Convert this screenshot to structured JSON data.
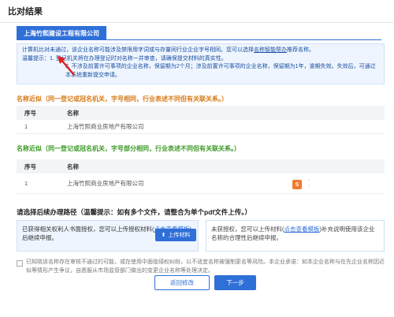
{
  "header": {
    "title": "比对结果"
  },
  "tab": {
    "company": "上海竹熙建设工程有限公司"
  },
  "notice": {
    "line1_prefix": "计算机比对未通过，该企业名称可能涉及禁限用字词或与存量同行业企业字号相同。您可以选择",
    "line1_link": "名称智能帮办",
    "line1_suffix": "推荐名称。",
    "line2": "温馨提示：1. 登记机关将在办理登记时对名称一并审查，请确保提交材料的真实性。",
    "line3": "2. 不涉及前置许可事项的企业名称，保留期为2个月；涉及前置许可事项的企业名称，保留期为1年，逾期失效。失效后，可通过本系统重新提交申请。"
  },
  "section1": {
    "title": "名称近似（同一登记或冠名机关，字号相同，行业表述不同但有关联关系。）",
    "columns": [
      "序号",
      "名称"
    ],
    "rows": [
      [
        "1",
        "上海竹熙商业房地产有限公司"
      ]
    ]
  },
  "section2": {
    "title": "名称近似（同一登记或冠名机关，字号部分相同，行业表述不同但有关联关系。）",
    "columns": [
      "序号",
      "名称"
    ],
    "rows": [
      [
        "1",
        "上海竹熙商业房地产有限公司"
      ]
    ]
  },
  "path": {
    "title": "请选择后续办理路径（温馨提示：如有多个文件，请整合为单个pdf文件上传。）",
    "left_text1": "已获得相关权利人书面授权，您可以上传授权材料(",
    "left_link": "点击查看模板",
    "left_text2": ")后继续申报。",
    "upload_label": "上传材料",
    "right_text1": "未获授权，您可以上传材料(",
    "right_link": "点击查看模板",
    "right_text2": ")补充说明使用该企业名称的合理性后继续申报。"
  },
  "agreement": "已知晓该名称存在审核不通过的可能，或在使用中面临侵权纠纷，以不适宜名称被强制更名等风险。本企业承诺：如本企业名称与在先企业名称因近似等情形产生争议，自愿服从市场监管部门做出的变更企业名称等处理决定。",
  "buttons": {
    "back": "返回修改",
    "next": "下一步"
  },
  "colors": {
    "accent": "#2f6fd8",
    "warning": "#d77a17",
    "success": "#3d9a27",
    "arrow": "#e02020"
  }
}
